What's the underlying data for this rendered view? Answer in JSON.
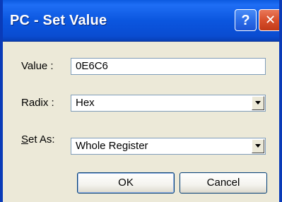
{
  "window": {
    "title": "PC - Set Value",
    "help_glyph": "?",
    "close_glyph": "✕"
  },
  "form": {
    "value_label": "Value :",
    "value": "0E6C6",
    "radix_label": "Radix :",
    "radix_selected": "Hex",
    "setas_label_prefix": "S",
    "setas_label_rest": "et As:",
    "setas_selected": "Whole Register"
  },
  "buttons": {
    "ok": "OK",
    "cancel": "Cancel"
  },
  "colors": {
    "titlebar": "#0b56df",
    "dialog_bg": "#ece9d8",
    "close_button": "#d8502d"
  }
}
